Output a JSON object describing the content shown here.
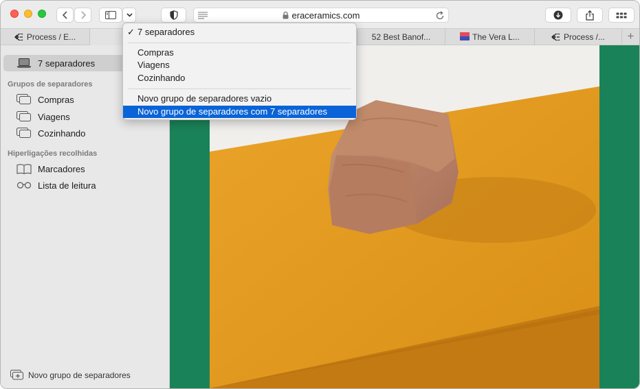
{
  "toolbar": {
    "address": "eraceramics.com"
  },
  "tabs": [
    {
      "label": "Process / E..."
    },
    {
      "label": ""
    },
    {
      "label": ""
    },
    {
      "label": "52 Best Banof..."
    },
    {
      "label": "The Vera L..."
    },
    {
      "label": "Process /..."
    }
  ],
  "tab_add_label": "+",
  "sidebar": {
    "current": "7 separadores",
    "groups_heading": "Grupos de separadores",
    "groups": [
      "Compras",
      "Viagens",
      "Cozinhando"
    ],
    "collections_heading": "Hiperligações recolhidas",
    "collections": [
      {
        "label": "Marcadores",
        "icon": "book-icon"
      },
      {
        "label": "Lista de leitura",
        "icon": "reading-glasses-icon"
      }
    ],
    "new_group": "Novo grupo de separadores"
  },
  "menu": {
    "checked_item": "7 separadores",
    "check_mark": "✓",
    "groups": [
      "Compras",
      "Viagens",
      "Cozinhando"
    ],
    "new_empty": "Novo grupo de separadores vazio",
    "new_with_tabs": "Novo grupo de separadores com 7 separadores"
  },
  "colors": {
    "accent": "#0a64d8",
    "content_green": "#1a8258",
    "orange": "#e6a227"
  }
}
